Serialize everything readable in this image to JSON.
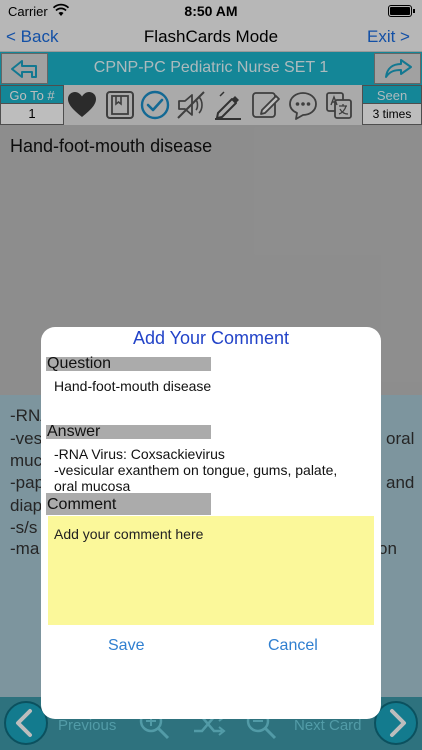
{
  "status": {
    "carrier": "Carrier",
    "time": "8:50 AM"
  },
  "nav": {
    "back": "< Back",
    "title": "FlashCards Mode",
    "exit": "Exit >"
  },
  "set": {
    "title": "CPNP-PC Pediatric Nurse SET 1"
  },
  "toolbar": {
    "goto_label": "Go To #",
    "goto_value": "1",
    "seen_label": "Seen",
    "seen_value": "3 times",
    "icons": [
      "heart-icon",
      "bookmark-icon",
      "check-circle-icon",
      "mute-icon",
      "edit-icon",
      "pencil-icon",
      "comment-icon",
      "translate-icon"
    ]
  },
  "card": {
    "question": "Hand-foot-mouth disease",
    "answer_fragments": [
      "-RNA",
      "-ves",
      "oral",
      "muc",
      "-pap",
      "and",
      "diap",
      "-s/s",
      "-ma",
      "on"
    ]
  },
  "bottom": {
    "previous": "Previous",
    "next": "Next Card"
  },
  "dialog": {
    "title": "Add Your Comment",
    "question_label": "Question",
    "question_text": "Hand-foot-mouth disease",
    "answer_label": "Answer",
    "answer_line1": "-RNA Virus: Coxsackievirus",
    "answer_line2": "-vesicular exanthem on tongue, gums, palate,",
    "answer_line3": "oral mucosa",
    "comment_label": "Comment",
    "comment_placeholder": "Add your comment here",
    "save": "Save",
    "cancel": "Cancel"
  },
  "colors": {
    "accent": "#1bb5cc",
    "link": "#1a6de0",
    "dialog_title": "#2243c8",
    "comment_bg": "#fbf89a"
  }
}
